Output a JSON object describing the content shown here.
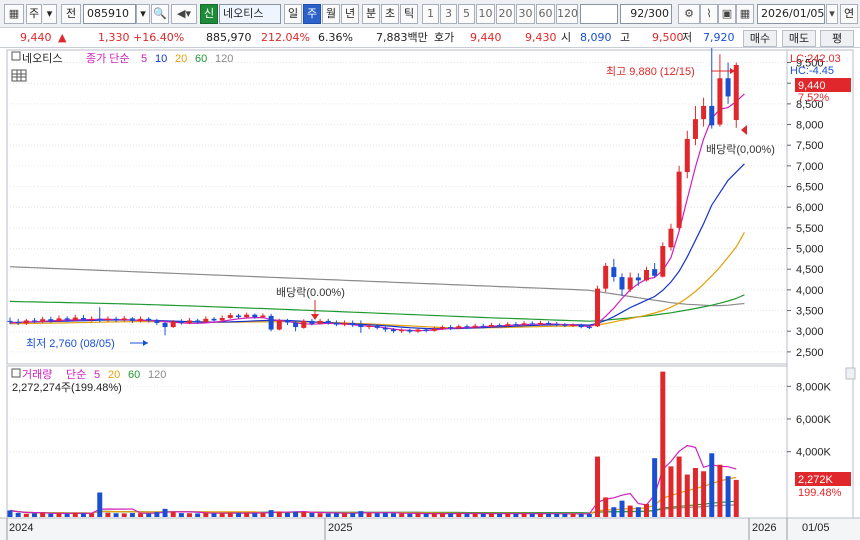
{
  "toolbar": {
    "market_prefix": "주",
    "jeon_label": "전",
    "stock_code": "085910",
    "shin_badge": "신",
    "stock_name": "네오티스",
    "periods": [
      "일",
      "주",
      "월",
      "년",
      "분",
      "초",
      "틱"
    ],
    "active_period": "주",
    "intervals": [
      "1",
      "3",
      "5",
      "10",
      "20",
      "30",
      "60",
      "120"
    ],
    "count_display": "92",
    "count_total": "/300",
    "date": "2026/01/05",
    "period_button": "연"
  },
  "quote": {
    "price": "9,440",
    "change": "1,330",
    "change_pct": "+16.40%",
    "volume": "885,970",
    "volume_ratio": "212.04%",
    "turnover": "6.36%",
    "amount": "7,883백만",
    "hoga_label": "호가",
    "ask": "9,440",
    "bid": "9,430",
    "open_label": "시",
    "open": "8,090",
    "high_label": "고",
    "high": "9,500",
    "low_label": "저",
    "low": "7,920",
    "buy_label": "매수",
    "sell_label": "매도",
    "eval_label": "평"
  },
  "price_chart": {
    "title": "네오티스",
    "ma_label": "종가 단순",
    "ma_periods": [
      "5",
      "10",
      "20",
      "60",
      "120"
    ],
    "ma_colors": {
      "5": "#d01fc0",
      "10": "#1533cc",
      "20": "#e3a008",
      "60": "#1f9a31",
      "120": "#8a8a8a"
    },
    "lc": "LC:242.03",
    "hc": "HC:-4.45",
    "price_tag": "9,440",
    "price_tag_pct": "7.52%",
    "max_note": "최고 9,880 (12/15)",
    "min_note": "최저 2,760 (08/05)",
    "div_note_1": "배당락(0.00%)",
    "div_note_2": "배당락(0,00%)",
    "ylabels": [
      "9,500",
      "9,000",
      "8,500",
      "8,000",
      "7,500",
      "7,000",
      "6,500",
      "6,000",
      "5,500",
      "5,000",
      "4,500",
      "4,000",
      "3,500",
      "3,000",
      "2,500"
    ]
  },
  "volume_chart": {
    "title": "거래량",
    "ma_label": "단순",
    "ma_periods": [
      "5",
      "20",
      "60",
      "120"
    ],
    "ma_colors": {
      "5": "#d01fc0",
      "20": "#e3a008",
      "60": "#1f9a31",
      "120": "#8a8a8a"
    },
    "current": "2,272,274주(199.48%)",
    "tag": "2,272K",
    "tag_pct": "199.48%",
    "ylabels": [
      "8,000K",
      "6,000K",
      "4,000K"
    ]
  },
  "x_axis": {
    "labels": [
      "2024",
      "2025",
      "2026"
    ],
    "right_label": "01/05"
  },
  "chart_data": {
    "type": "candlestick",
    "title": "네오티스",
    "ylim": [
      2400,
      9900
    ],
    "volume_max_k": 9000,
    "candles": [
      [
        3250,
        3230,
        3330,
        3170,
        400
      ],
      [
        3220,
        3200,
        3300,
        3150,
        250
      ],
      [
        3190,
        3260,
        3300,
        3150,
        200
      ],
      [
        3260,
        3240,
        3320,
        3200,
        220
      ],
      [
        3230,
        3290,
        3350,
        3200,
        250
      ],
      [
        3290,
        3250,
        3350,
        3210,
        200
      ],
      [
        3250,
        3310,
        3380,
        3220,
        230
      ],
      [
        3310,
        3280,
        3360,
        3230,
        200
      ],
      [
        3270,
        3330,
        3400,
        3240,
        260
      ],
      [
        3320,
        3280,
        3390,
        3240,
        220
      ],
      [
        3280,
        3300,
        3360,
        3230,
        210
      ],
      [
        3300,
        3260,
        3580,
        3220,
        1500
      ],
      [
        3270,
        3300,
        3360,
        3230,
        260
      ],
      [
        3300,
        3270,
        3350,
        3220,
        230
      ],
      [
        3270,
        3310,
        3370,
        3230,
        220
      ],
      [
        3310,
        3250,
        3340,
        3200,
        240
      ],
      [
        3250,
        3300,
        3360,
        3210,
        230
      ],
      [
        3300,
        3260,
        3340,
        3210,
        210
      ],
      [
        3260,
        3200,
        3300,
        3150,
        300
      ],
      [
        3200,
        3100,
        3230,
        2900,
        500
      ],
      [
        3100,
        3230,
        3270,
        3080,
        320
      ],
      [
        3230,
        3200,
        3290,
        3160,
        240
      ],
      [
        3200,
        3260,
        3320,
        3170,
        230
      ],
      [
        3260,
        3220,
        3300,
        3180,
        220
      ],
      [
        3220,
        3300,
        3360,
        3200,
        250
      ],
      [
        3300,
        3260,
        3340,
        3230,
        220
      ],
      [
        3260,
        3320,
        3380,
        3230,
        230
      ],
      [
        3320,
        3390,
        3440,
        3300,
        260
      ],
      [
        3380,
        3340,
        3420,
        3300,
        240
      ],
      [
        3340,
        3400,
        3450,
        3320,
        250
      ],
      [
        3400,
        3340,
        3430,
        3300,
        230
      ],
      [
        3340,
        3380,
        3430,
        3310,
        240
      ],
      [
        3370,
        3040,
        3420,
        3000,
        420
      ],
      [
        3040,
        3260,
        3300,
        3020,
        340
      ],
      [
        3260,
        3210,
        3300,
        3150,
        260
      ],
      [
        3210,
        3100,
        3260,
        3000,
        330
      ],
      [
        3080,
        3250,
        3290,
        3060,
        300
      ],
      [
        3250,
        3180,
        3300,
        3140,
        250
      ],
      [
        3180,
        3250,
        3300,
        3160,
        230
      ],
      [
        3250,
        3200,
        3300,
        3160,
        220
      ],
      [
        3200,
        3160,
        3260,
        3120,
        230
      ],
      [
        3160,
        3200,
        3260,
        3120,
        220
      ],
      [
        3200,
        3150,
        3260,
        3100,
        230
      ],
      [
        3150,
        3100,
        3260,
        2960,
        360
      ],
      [
        3100,
        3130,
        3180,
        3050,
        240
      ],
      [
        3130,
        3080,
        3170,
        3040,
        230
      ],
      [
        3080,
        3040,
        3120,
        2980,
        250
      ],
      [
        3040,
        3000,
        3080,
        2960,
        230
      ],
      [
        3000,
        3030,
        3070,
        2960,
        210
      ],
      [
        3030,
        2990,
        3060,
        2950,
        200
      ],
      [
        2990,
        3040,
        3080,
        2960,
        210
      ],
      [
        3040,
        3010,
        3080,
        2970,
        200
      ],
      [
        3010,
        3060,
        3110,
        2990,
        210
      ],
      [
        3060,
        3100,
        3140,
        3030,
        220
      ],
      [
        3100,
        3070,
        3150,
        3030,
        210
      ],
      [
        3070,
        3120,
        3160,
        3050,
        220
      ],
      [
        3120,
        3090,
        3160,
        3050,
        200
      ],
      [
        3090,
        3130,
        3180,
        3060,
        210
      ],
      [
        3130,
        3110,
        3180,
        3070,
        200
      ],
      [
        3110,
        3150,
        3200,
        3080,
        210
      ],
      [
        3150,
        3130,
        3190,
        3090,
        200
      ],
      [
        3130,
        3170,
        3220,
        3100,
        210
      ],
      [
        3170,
        3160,
        3220,
        3120,
        200
      ],
      [
        3160,
        3190,
        3240,
        3130,
        210
      ],
      [
        3190,
        3170,
        3240,
        3130,
        200
      ],
      [
        3170,
        3200,
        3250,
        3140,
        210
      ],
      [
        3200,
        3180,
        3240,
        3140,
        200
      ],
      [
        3180,
        3160,
        3220,
        3120,
        190
      ],
      [
        3160,
        3130,
        3200,
        3100,
        190
      ],
      [
        3130,
        3150,
        3190,
        3100,
        200
      ],
      [
        3150,
        3100,
        3180,
        3070,
        190
      ],
      [
        3100,
        3080,
        3140,
        3050,
        180
      ],
      [
        3120,
        4030,
        4100,
        3100,
        3700
      ],
      [
        4030,
        4580,
        4650,
        3950,
        1200
      ],
      [
        4550,
        4310,
        4750,
        4200,
        600
      ],
      [
        4310,
        4010,
        4400,
        3850,
        1000
      ],
      [
        4010,
        4300,
        4420,
        3950,
        700
      ],
      [
        4300,
        4230,
        4400,
        4100,
        600
      ],
      [
        4230,
        4480,
        4560,
        4200,
        800
      ],
      [
        4500,
        4340,
        4650,
        4300,
        3600
      ],
      [
        4320,
        5060,
        5150,
        4300,
        8900
      ],
      [
        5030,
        5480,
        5600,
        4950,
        3100
      ],
      [
        5500,
        6860,
        7000,
        5450,
        3700
      ],
      [
        6850,
        7650,
        7850,
        6700,
        2600
      ],
      [
        7650,
        8130,
        8450,
        7500,
        3000
      ],
      [
        8130,
        8450,
        8650,
        7950,
        2800
      ],
      [
        8450,
        7980,
        9880,
        7900,
        3900
      ],
      [
        8000,
        9120,
        9700,
        7950,
        3200
      ],
      [
        9120,
        8680,
        9500,
        8500,
        2500
      ],
      [
        8110,
        9440,
        9500,
        7920,
        2272
      ]
    ],
    "ma5": [
      3200,
      3210,
      3220,
      3230,
      3240,
      3250,
      3260,
      3270,
      3270,
      3280,
      3280,
      3290,
      3290,
      3280,
      3280,
      3270,
      3260,
      3260,
      3250,
      3230,
      3220,
      3200,
      3190,
      3190,
      3200,
      3220,
      3240,
      3270,
      3300,
      3320,
      3330,
      3330,
      3280,
      3260,
      3240,
      3200,
      3180,
      3170,
      3180,
      3190,
      3180,
      3170,
      3160,
      3130,
      3120,
      3110,
      3080,
      3050,
      3030,
      3020,
      3010,
      3020,
      3030,
      3050,
      3070,
      3080,
      3090,
      3100,
      3110,
      3120,
      3130,
      3140,
      3150,
      3160,
      3170,
      3170,
      3180,
      3170,
      3160,
      3150,
      3130,
      3110,
      3190,
      3360,
      3560,
      3790,
      4000,
      4150,
      4260,
      4300,
      4470,
      4780,
      5420,
      6200,
      6970,
      7650,
      8150,
      8370,
      8410,
      8560,
      8740
    ],
    "ma10": [
      3210,
      3215,
      3220,
      3225,
      3230,
      3235,
      3240,
      3245,
      3250,
      3255,
      3260,
      3265,
      3270,
      3270,
      3270,
      3268,
      3265,
      3262,
      3258,
      3252,
      3245,
      3238,
      3230,
      3225,
      3220,
      3220,
      3222,
      3226,
      3232,
      3240,
      3248,
      3256,
      3262,
      3262,
      3258,
      3250,
      3240,
      3228,
      3216,
      3205,
      3195,
      3185,
      3175,
      3165,
      3155,
      3145,
      3130,
      3115,
      3100,
      3085,
      3075,
      3065,
      3060,
      3060,
      3062,
      3066,
      3072,
      3080,
      3088,
      3096,
      3105,
      3114,
      3122,
      3130,
      3138,
      3146,
      3152,
      3156,
      3158,
      3158,
      3154,
      3148,
      3190,
      3260,
      3350,
      3460,
      3570,
      3660,
      3750,
      3840,
      3990,
      4190,
      4450,
      4800,
      5200,
      5600,
      6050,
      6350,
      6650,
      6850,
      7050
    ],
    "ma20": [
      3180,
      3183,
      3186,
      3189,
      3192,
      3195,
      3198,
      3202,
      3206,
      3210,
      3214,
      3218,
      3222,
      3225,
      3228,
      3230,
      3232,
      3233,
      3233,
      3232,
      3230,
      3228,
      3226,
      3224,
      3222,
      3221,
      3220,
      3220,
      3221,
      3222,
      3224,
      3226,
      3228,
      3229,
      3229,
      3228,
      3226,
      3222,
      3218,
      3212,
      3206,
      3200,
      3192,
      3184,
      3176,
      3168,
      3158,
      3148,
      3138,
      3128,
      3118,
      3108,
      3098,
      3090,
      3084,
      3080,
      3078,
      3078,
      3080,
      3084,
      3088,
      3092,
      3097,
      3102,
      3107,
      3112,
      3116,
      3120,
      3123,
      3126,
      3128,
      3128,
      3150,
      3185,
      3225,
      3265,
      3305,
      3345,
      3390,
      3440,
      3500,
      3580,
      3680,
      3810,
      3960,
      4140,
      4340,
      4550,
      4790,
      5040,
      5390
    ],
    "ma60": [
      3720,
      3716,
      3712,
      3708,
      3704,
      3700,
      3696,
      3692,
      3688,
      3684,
      3680,
      3676,
      3671,
      3666,
      3661,
      3656,
      3650,
      3644,
      3638,
      3632,
      3625,
      3618,
      3611,
      3604,
      3597,
      3590,
      3583,
      3576,
      3569,
      3562,
      3555,
      3548,
      3540,
      3532,
      3524,
      3516,
      3508,
      3500,
      3492,
      3484,
      3476,
      3468,
      3460,
      3452,
      3444,
      3436,
      3428,
      3420,
      3412,
      3404,
      3396,
      3388,
      3380,
      3372,
      3364,
      3356,
      3348,
      3340,
      3332,
      3325,
      3318,
      3311,
      3304,
      3297,
      3290,
      3283,
      3276,
      3269,
      3262,
      3255,
      3248,
      3241,
      3248,
      3265,
      3285,
      3305,
      3325,
      3345,
      3368,
      3392,
      3418,
      3446,
      3478,
      3512,
      3548,
      3588,
      3630,
      3678,
      3730,
      3790,
      3880
    ],
    "ma120": [
      4560,
      4552,
      4544,
      4536,
      4528,
      4520,
      4512,
      4504,
      4496,
      4488,
      4480,
      4472,
      4464,
      4456,
      4448,
      4440,
      4432,
      4424,
      4416,
      4408,
      4400,
      4392,
      4384,
      4376,
      4368,
      4360,
      4352,
      4344,
      4336,
      4328,
      4320,
      4312,
      4304,
      4296,
      4288,
      4280,
      4272,
      4264,
      4256,
      4248,
      4240,
      4232,
      4224,
      4216,
      4208,
      4200,
      4192,
      4184,
      4176,
      4168,
      4160,
      4152,
      4144,
      4136,
      4128,
      4120,
      4112,
      4104,
      4096,
      4088,
      4080,
      4072,
      4064,
      4056,
      4048,
      4040,
      4032,
      4024,
      4016,
      4008,
      4000,
      3990,
      3960,
      3930,
      3900,
      3870,
      3840,
      3810,
      3780,
      3750,
      3720,
      3690,
      3670,
      3650,
      3640,
      3630,
      3620,
      3620,
      3630,
      3650,
      3670
    ]
  }
}
